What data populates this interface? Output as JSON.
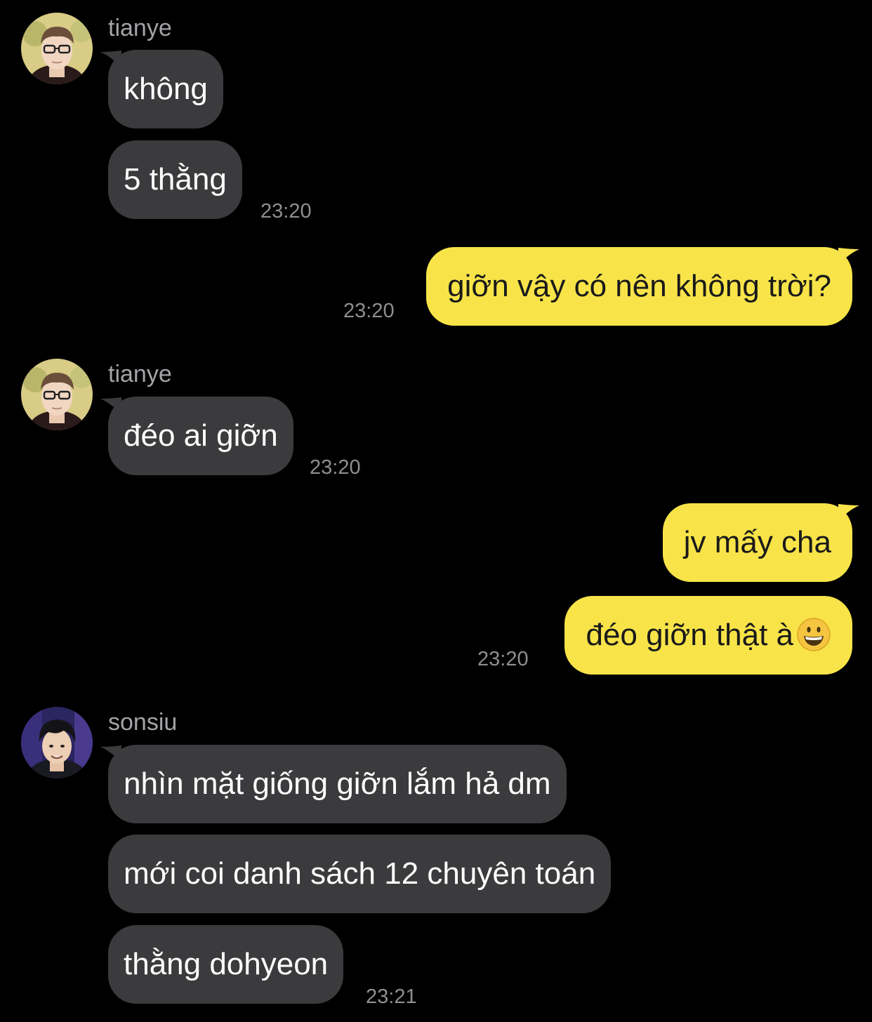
{
  "theme": {
    "background": "#000000",
    "incoming_bubble": "#3b3b3d",
    "outgoing_bubble": "#f8e449",
    "timestamp_color": "#8e8e93",
    "sender_color": "#a3a3a8"
  },
  "chat": {
    "group1": {
      "sender": "tianye",
      "messages": [
        "không",
        "5 thằng"
      ],
      "time": "23:20"
    },
    "out1": {
      "messages": [
        "giỡn vậy có nên không trời?"
      ],
      "time": "23:20"
    },
    "group2": {
      "sender": "tianye",
      "messages": [
        "đéo ai giỡn"
      ],
      "time": "23:20"
    },
    "out2": {
      "messages": [
        "jv mấy cha",
        "đéo giỡn thật à"
      ],
      "emoji": "grinning-face-emoji",
      "time": "23:20"
    },
    "group3": {
      "sender": "sonsiu",
      "messages": [
        "nhìn mặt giống giỡn lắm hả dm",
        "mới coi danh sách 12 chuyên toán",
        "thằng dohyeon"
      ],
      "time": "23:21"
    }
  }
}
